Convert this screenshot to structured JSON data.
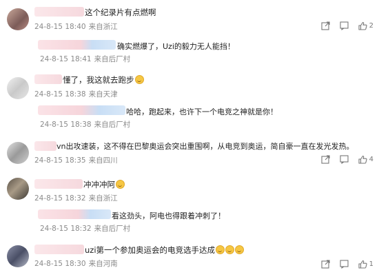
{
  "comments": [
    {
      "text": "这个纪录片有点燃啊",
      "date": "24-8-15 18:40",
      "location": "来自浙江",
      "likes": "2",
      "reply": {
        "text": "确实燃爆了，Uzi的毅力无人能挡！",
        "date": "24-8-15 18:41",
        "location": "来自后厂村"
      }
    },
    {
      "text": "懂了，我这就去跑步",
      "date": "24-8-15 18:38",
      "location": "来自天津",
      "likes": "",
      "reply": {
        "text": "哈哈，跑起来，也许下一个电竞之神就是你！",
        "date": "24-8-15 18:38",
        "location": "来自后厂村"
      }
    },
    {
      "text": "vn出攻速装，这不得在巴黎奥运会突出重围啊，从电竞到奥运，简自豪一直在发光发热。",
      "date": "24-8-15 18:35",
      "location": "来自四川",
      "likes": "4",
      "reply": null
    },
    {
      "text": "冲冲冲阿",
      "date": "24-8-15 18:32",
      "location": "来自浙江",
      "likes": "",
      "reply": {
        "text": "看这劲头，阿电也得跟着冲刺了！",
        "date": "24-8-15 18:32",
        "location": "来自后厂村"
      }
    },
    {
      "text": "uzi第一个参加奥运会的电竞选手达成",
      "date": "24-8-15 18:30",
      "location": "来自河南",
      "likes": "1",
      "reply": null
    }
  ],
  "icons": {
    "share": "share-icon",
    "comment": "comment-icon",
    "like": "like-icon"
  },
  "colors": {
    "meta": "#8a8a8a",
    "blur_pink": "#f3c9cf",
    "blur_blue": "#bcd6f2"
  }
}
